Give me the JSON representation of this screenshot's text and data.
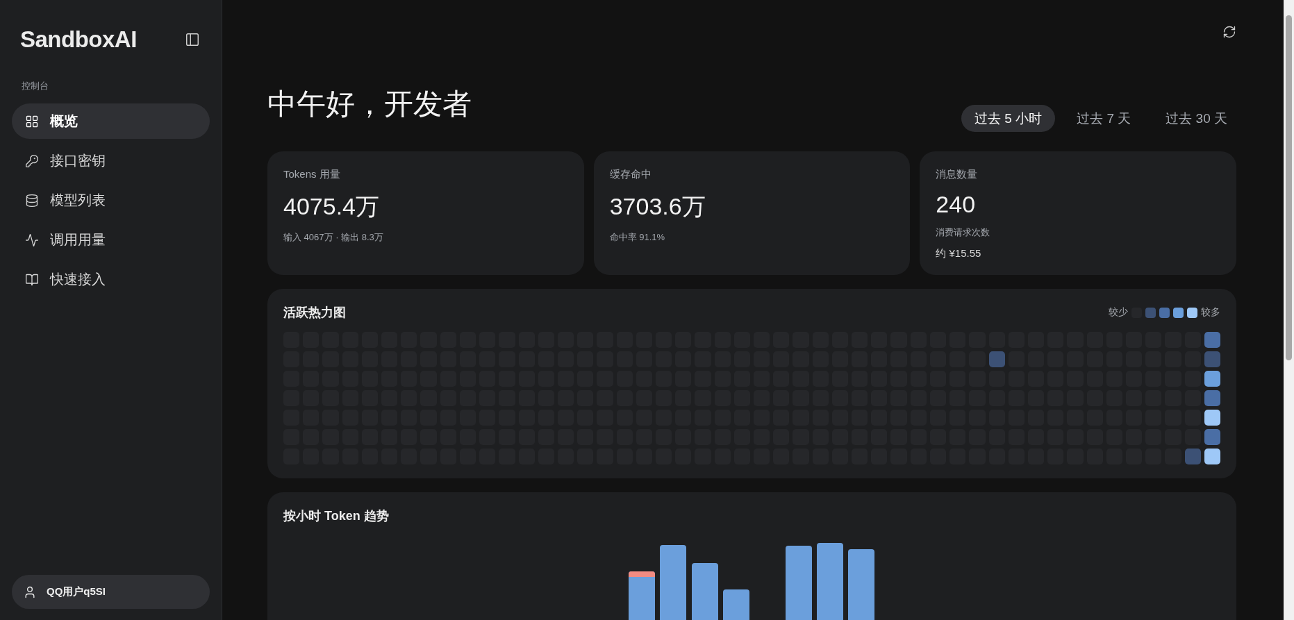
{
  "sidebar": {
    "logo": "SandboxAI",
    "section": "控制台",
    "items": [
      {
        "label": "概览",
        "selected": true
      },
      {
        "label": "接口密钥",
        "selected": false
      },
      {
        "label": "模型列表",
        "selected": false
      },
      {
        "label": "调用用量",
        "selected": false
      },
      {
        "label": "快速接入",
        "selected": false
      }
    ],
    "user": "QQ用户q5SI"
  },
  "greeting": "中午好，开发者",
  "ranges": [
    {
      "label": "过去 5 小时",
      "selected": true
    },
    {
      "label": "过去 7 天",
      "selected": false
    },
    {
      "label": "过去 30 天",
      "selected": false
    }
  ],
  "stats": [
    {
      "label": "Tokens 用量",
      "value": "4075.4万",
      "sub": "输入 4067万 · 输出 8.3万"
    },
    {
      "label": "缓存命中",
      "value": "3703.6万",
      "sub": "命中率 91.1%"
    },
    {
      "label": "消息数量",
      "value": "240",
      "sub": "消费请求次数",
      "extra": "约 ¥15.55"
    }
  ],
  "heatmap": {
    "title": "活跃热力图",
    "legend_less": "较少",
    "legend_more": "较多",
    "legend": [
      {
        "color": "#26272a"
      },
      {
        "color": "#3c5175"
      },
      {
        "color": "#4a6ea5"
      },
      {
        "color": "#6b9fdc"
      },
      {
        "color": "#9ec8f7"
      }
    ],
    "columns": [
      {
        "cells": [
          {
            "color": "#26272a"
          },
          {
            "color": "#26272a"
          },
          {
            "color": "#26272a"
          },
          {
            "color": "#26272a"
          },
          {
            "color": "#26272a"
          },
          {
            "color": "#26272a"
          },
          {
            "color": "#26272a"
          }
        ]
      },
      {
        "cells": [
          {
            "color": "#26272a"
          },
          {
            "color": "#26272a"
          },
          {
            "color": "#26272a"
          },
          {
            "color": "#26272a"
          },
          {
            "color": "#26272a"
          },
          {
            "color": "#26272a"
          },
          {
            "color": "#26272a"
          }
        ]
      },
      {
        "cells": [
          {
            "color": "#26272a"
          },
          {
            "color": "#26272a"
          },
          {
            "color": "#26272a"
          },
          {
            "color": "#26272a"
          },
          {
            "color": "#26272a"
          },
          {
            "color": "#26272a"
          },
          {
            "color": "#26272a"
          }
        ]
      },
      {
        "cells": [
          {
            "color": "#26272a"
          },
          {
            "color": "#26272a"
          },
          {
            "color": "#26272a"
          },
          {
            "color": "#26272a"
          },
          {
            "color": "#26272a"
          },
          {
            "color": "#26272a"
          },
          {
            "color": "#26272a"
          }
        ]
      },
      {
        "cells": [
          {
            "color": "#26272a"
          },
          {
            "color": "#26272a"
          },
          {
            "color": "#26272a"
          },
          {
            "color": "#26272a"
          },
          {
            "color": "#26272a"
          },
          {
            "color": "#26272a"
          },
          {
            "color": "#26272a"
          }
        ]
      },
      {
        "cells": [
          {
            "color": "#26272a"
          },
          {
            "color": "#26272a"
          },
          {
            "color": "#26272a"
          },
          {
            "color": "#26272a"
          },
          {
            "color": "#26272a"
          },
          {
            "color": "#26272a"
          },
          {
            "color": "#26272a"
          }
        ]
      },
      {
        "cells": [
          {
            "color": "#26272a"
          },
          {
            "color": "#26272a"
          },
          {
            "color": "#26272a"
          },
          {
            "color": "#26272a"
          },
          {
            "color": "#26272a"
          },
          {
            "color": "#26272a"
          },
          {
            "color": "#26272a"
          }
        ]
      },
      {
        "cells": [
          {
            "color": "#26272a"
          },
          {
            "color": "#26272a"
          },
          {
            "color": "#26272a"
          },
          {
            "color": "#26272a"
          },
          {
            "color": "#26272a"
          },
          {
            "color": "#26272a"
          },
          {
            "color": "#26272a"
          }
        ]
      },
      {
        "cells": [
          {
            "color": "#26272a"
          },
          {
            "color": "#26272a"
          },
          {
            "color": "#26272a"
          },
          {
            "color": "#26272a"
          },
          {
            "color": "#26272a"
          },
          {
            "color": "#26272a"
          },
          {
            "color": "#26272a"
          }
        ]
      },
      {
        "cells": [
          {
            "color": "#26272a"
          },
          {
            "color": "#26272a"
          },
          {
            "color": "#26272a"
          },
          {
            "color": "#26272a"
          },
          {
            "color": "#26272a"
          },
          {
            "color": "#26272a"
          },
          {
            "color": "#26272a"
          }
        ]
      },
      {
        "cells": [
          {
            "color": "#26272a"
          },
          {
            "color": "#26272a"
          },
          {
            "color": "#26272a"
          },
          {
            "color": "#26272a"
          },
          {
            "color": "#26272a"
          },
          {
            "color": "#26272a"
          },
          {
            "color": "#26272a"
          }
        ]
      },
      {
        "cells": [
          {
            "color": "#26272a"
          },
          {
            "color": "#26272a"
          },
          {
            "color": "#26272a"
          },
          {
            "color": "#26272a"
          },
          {
            "color": "#26272a"
          },
          {
            "color": "#26272a"
          },
          {
            "color": "#26272a"
          }
        ]
      },
      {
        "cells": [
          {
            "color": "#26272a"
          },
          {
            "color": "#26272a"
          },
          {
            "color": "#26272a"
          },
          {
            "color": "#26272a"
          },
          {
            "color": "#26272a"
          },
          {
            "color": "#26272a"
          },
          {
            "color": "#26272a"
          }
        ]
      },
      {
        "cells": [
          {
            "color": "#26272a"
          },
          {
            "color": "#26272a"
          },
          {
            "color": "#26272a"
          },
          {
            "color": "#26272a"
          },
          {
            "color": "#26272a"
          },
          {
            "color": "#26272a"
          },
          {
            "color": "#26272a"
          }
        ]
      },
      {
        "cells": [
          {
            "color": "#26272a"
          },
          {
            "color": "#26272a"
          },
          {
            "color": "#26272a"
          },
          {
            "color": "#26272a"
          },
          {
            "color": "#26272a"
          },
          {
            "color": "#26272a"
          },
          {
            "color": "#26272a"
          }
        ]
      },
      {
        "cells": [
          {
            "color": "#26272a"
          },
          {
            "color": "#26272a"
          },
          {
            "color": "#26272a"
          },
          {
            "color": "#26272a"
          },
          {
            "color": "#26272a"
          },
          {
            "color": "#26272a"
          },
          {
            "color": "#26272a"
          }
        ]
      },
      {
        "cells": [
          {
            "color": "#26272a"
          },
          {
            "color": "#26272a"
          },
          {
            "color": "#26272a"
          },
          {
            "color": "#26272a"
          },
          {
            "color": "#26272a"
          },
          {
            "color": "#26272a"
          },
          {
            "color": "#26272a"
          }
        ]
      },
      {
        "cells": [
          {
            "color": "#26272a"
          },
          {
            "color": "#26272a"
          },
          {
            "color": "#26272a"
          },
          {
            "color": "#26272a"
          },
          {
            "color": "#26272a"
          },
          {
            "color": "#26272a"
          },
          {
            "color": "#26272a"
          }
        ]
      },
      {
        "cells": [
          {
            "color": "#26272a"
          },
          {
            "color": "#26272a"
          },
          {
            "color": "#26272a"
          },
          {
            "color": "#26272a"
          },
          {
            "color": "#26272a"
          },
          {
            "color": "#26272a"
          },
          {
            "color": "#26272a"
          }
        ]
      },
      {
        "cells": [
          {
            "color": "#26272a"
          },
          {
            "color": "#26272a"
          },
          {
            "color": "#26272a"
          },
          {
            "color": "#26272a"
          },
          {
            "color": "#26272a"
          },
          {
            "color": "#26272a"
          },
          {
            "color": "#26272a"
          }
        ]
      },
      {
        "cells": [
          {
            "color": "#26272a"
          },
          {
            "color": "#26272a"
          },
          {
            "color": "#26272a"
          },
          {
            "color": "#26272a"
          },
          {
            "color": "#26272a"
          },
          {
            "color": "#26272a"
          },
          {
            "color": "#26272a"
          }
        ]
      },
      {
        "cells": [
          {
            "color": "#26272a"
          },
          {
            "color": "#26272a"
          },
          {
            "color": "#26272a"
          },
          {
            "color": "#26272a"
          },
          {
            "color": "#26272a"
          },
          {
            "color": "#26272a"
          },
          {
            "color": "#26272a"
          }
        ]
      },
      {
        "cells": [
          {
            "color": "#26272a"
          },
          {
            "color": "#26272a"
          },
          {
            "color": "#26272a"
          },
          {
            "color": "#26272a"
          },
          {
            "color": "#26272a"
          },
          {
            "color": "#26272a"
          },
          {
            "color": "#26272a"
          }
        ]
      },
      {
        "cells": [
          {
            "color": "#26272a"
          },
          {
            "color": "#26272a"
          },
          {
            "color": "#26272a"
          },
          {
            "color": "#26272a"
          },
          {
            "color": "#26272a"
          },
          {
            "color": "#26272a"
          },
          {
            "color": "#26272a"
          }
        ]
      },
      {
        "cells": [
          {
            "color": "#26272a"
          },
          {
            "color": "#26272a"
          },
          {
            "color": "#26272a"
          },
          {
            "color": "#26272a"
          },
          {
            "color": "#26272a"
          },
          {
            "color": "#26272a"
          },
          {
            "color": "#26272a"
          }
        ]
      },
      {
        "cells": [
          {
            "color": "#26272a"
          },
          {
            "color": "#26272a"
          },
          {
            "color": "#26272a"
          },
          {
            "color": "#26272a"
          },
          {
            "color": "#26272a"
          },
          {
            "color": "#26272a"
          },
          {
            "color": "#26272a"
          }
        ]
      },
      {
        "cells": [
          {
            "color": "#26272a"
          },
          {
            "color": "#26272a"
          },
          {
            "color": "#26272a"
          },
          {
            "color": "#26272a"
          },
          {
            "color": "#26272a"
          },
          {
            "color": "#26272a"
          },
          {
            "color": "#26272a"
          }
        ]
      },
      {
        "cells": [
          {
            "color": "#26272a"
          },
          {
            "color": "#26272a"
          },
          {
            "color": "#26272a"
          },
          {
            "color": "#26272a"
          },
          {
            "color": "#26272a"
          },
          {
            "color": "#26272a"
          },
          {
            "color": "#26272a"
          }
        ]
      },
      {
        "cells": [
          {
            "color": "#26272a"
          },
          {
            "color": "#26272a"
          },
          {
            "color": "#26272a"
          },
          {
            "color": "#26272a"
          },
          {
            "color": "#26272a"
          },
          {
            "color": "#26272a"
          },
          {
            "color": "#26272a"
          }
        ]
      },
      {
        "cells": [
          {
            "color": "#26272a"
          },
          {
            "color": "#26272a"
          },
          {
            "color": "#26272a"
          },
          {
            "color": "#26272a"
          },
          {
            "color": "#26272a"
          },
          {
            "color": "#26272a"
          },
          {
            "color": "#26272a"
          }
        ]
      },
      {
        "cells": [
          {
            "color": "#26272a"
          },
          {
            "color": "#26272a"
          },
          {
            "color": "#26272a"
          },
          {
            "color": "#26272a"
          },
          {
            "color": "#26272a"
          },
          {
            "color": "#26272a"
          },
          {
            "color": "#26272a"
          }
        ]
      },
      {
        "cells": [
          {
            "color": "#26272a"
          },
          {
            "color": "#26272a"
          },
          {
            "color": "#26272a"
          },
          {
            "color": "#26272a"
          },
          {
            "color": "#26272a"
          },
          {
            "color": "#26272a"
          },
          {
            "color": "#26272a"
          }
        ]
      },
      {
        "cells": [
          {
            "color": "#26272a"
          },
          {
            "color": "#26272a"
          },
          {
            "color": "#26272a"
          },
          {
            "color": "#26272a"
          },
          {
            "color": "#26272a"
          },
          {
            "color": "#26272a"
          },
          {
            "color": "#26272a"
          }
        ]
      },
      {
        "cells": [
          {
            "color": "#26272a"
          },
          {
            "color": "#26272a"
          },
          {
            "color": "#26272a"
          },
          {
            "color": "#26272a"
          },
          {
            "color": "#26272a"
          },
          {
            "color": "#26272a"
          },
          {
            "color": "#26272a"
          }
        ]
      },
      {
        "cells": [
          {
            "color": "#26272a"
          },
          {
            "color": "#26272a"
          },
          {
            "color": "#26272a"
          },
          {
            "color": "#26272a"
          },
          {
            "color": "#26272a"
          },
          {
            "color": "#26272a"
          },
          {
            "color": "#26272a"
          }
        ]
      },
      {
        "cells": [
          {
            "color": "#26272a"
          },
          {
            "color": "#26272a"
          },
          {
            "color": "#26272a"
          },
          {
            "color": "#26272a"
          },
          {
            "color": "#26272a"
          },
          {
            "color": "#26272a"
          },
          {
            "color": "#26272a"
          }
        ]
      },
      {
        "cells": [
          {
            "color": "#26272a"
          },
          {
            "color": "#3c5175"
          },
          {
            "color": "#26272a"
          },
          {
            "color": "#26272a"
          },
          {
            "color": "#26272a"
          },
          {
            "color": "#26272a"
          },
          {
            "color": "#26272a"
          }
        ]
      },
      {
        "cells": [
          {
            "color": "#26272a"
          },
          {
            "color": "#26272a"
          },
          {
            "color": "#26272a"
          },
          {
            "color": "#26272a"
          },
          {
            "color": "#26272a"
          },
          {
            "color": "#26272a"
          },
          {
            "color": "#26272a"
          }
        ]
      },
      {
        "cells": [
          {
            "color": "#26272a"
          },
          {
            "color": "#26272a"
          },
          {
            "color": "#26272a"
          },
          {
            "color": "#26272a"
          },
          {
            "color": "#26272a"
          },
          {
            "color": "#26272a"
          },
          {
            "color": "#26272a"
          }
        ]
      },
      {
        "cells": [
          {
            "color": "#26272a"
          },
          {
            "color": "#26272a"
          },
          {
            "color": "#26272a"
          },
          {
            "color": "#26272a"
          },
          {
            "color": "#26272a"
          },
          {
            "color": "#26272a"
          },
          {
            "color": "#26272a"
          }
        ]
      },
      {
        "cells": [
          {
            "color": "#26272a"
          },
          {
            "color": "#26272a"
          },
          {
            "color": "#26272a"
          },
          {
            "color": "#26272a"
          },
          {
            "color": "#26272a"
          },
          {
            "color": "#26272a"
          },
          {
            "color": "#26272a"
          }
        ]
      },
      {
        "cells": [
          {
            "color": "#26272a"
          },
          {
            "color": "#26272a"
          },
          {
            "color": "#26272a"
          },
          {
            "color": "#26272a"
          },
          {
            "color": "#26272a"
          },
          {
            "color": "#26272a"
          },
          {
            "color": "#26272a"
          }
        ]
      },
      {
        "cells": [
          {
            "color": "#26272a"
          },
          {
            "color": "#26272a"
          },
          {
            "color": "#26272a"
          },
          {
            "color": "#26272a"
          },
          {
            "color": "#26272a"
          },
          {
            "color": "#26272a"
          },
          {
            "color": "#26272a"
          }
        ]
      },
      {
        "cells": [
          {
            "color": "#26272a"
          },
          {
            "color": "#26272a"
          },
          {
            "color": "#26272a"
          },
          {
            "color": "#26272a"
          },
          {
            "color": "#26272a"
          },
          {
            "color": "#26272a"
          },
          {
            "color": "#26272a"
          }
        ]
      },
      {
        "cells": [
          {
            "color": "#26272a"
          },
          {
            "color": "#26272a"
          },
          {
            "color": "#26272a"
          },
          {
            "color": "#26272a"
          },
          {
            "color": "#26272a"
          },
          {
            "color": "#26272a"
          },
          {
            "color": "#26272a"
          }
        ]
      },
      {
        "cells": [
          {
            "color": "#26272a"
          },
          {
            "color": "#26272a"
          },
          {
            "color": "#26272a"
          },
          {
            "color": "#26272a"
          },
          {
            "color": "#26272a"
          },
          {
            "color": "#26272a"
          },
          {
            "color": "#26272a"
          }
        ]
      },
      {
        "cells": [
          {
            "color": "#26272a"
          },
          {
            "color": "#26272a"
          },
          {
            "color": "#26272a"
          },
          {
            "color": "#26272a"
          },
          {
            "color": "#26272a"
          },
          {
            "color": "#26272a"
          },
          {
            "color": "#3c5175"
          }
        ]
      },
      {
        "cells": [
          {
            "color": "#4a6ea5"
          },
          {
            "color": "#3c5175"
          },
          {
            "color": "#6b9fdc"
          },
          {
            "color": "#4a6ea5"
          },
          {
            "color": "#9ec8f7"
          },
          {
            "color": "#4a6ea5"
          },
          {
            "color": "#9ec8f7"
          }
        ]
      }
    ]
  },
  "trend": {
    "title": "按小时 Token 趋势"
  }
}
